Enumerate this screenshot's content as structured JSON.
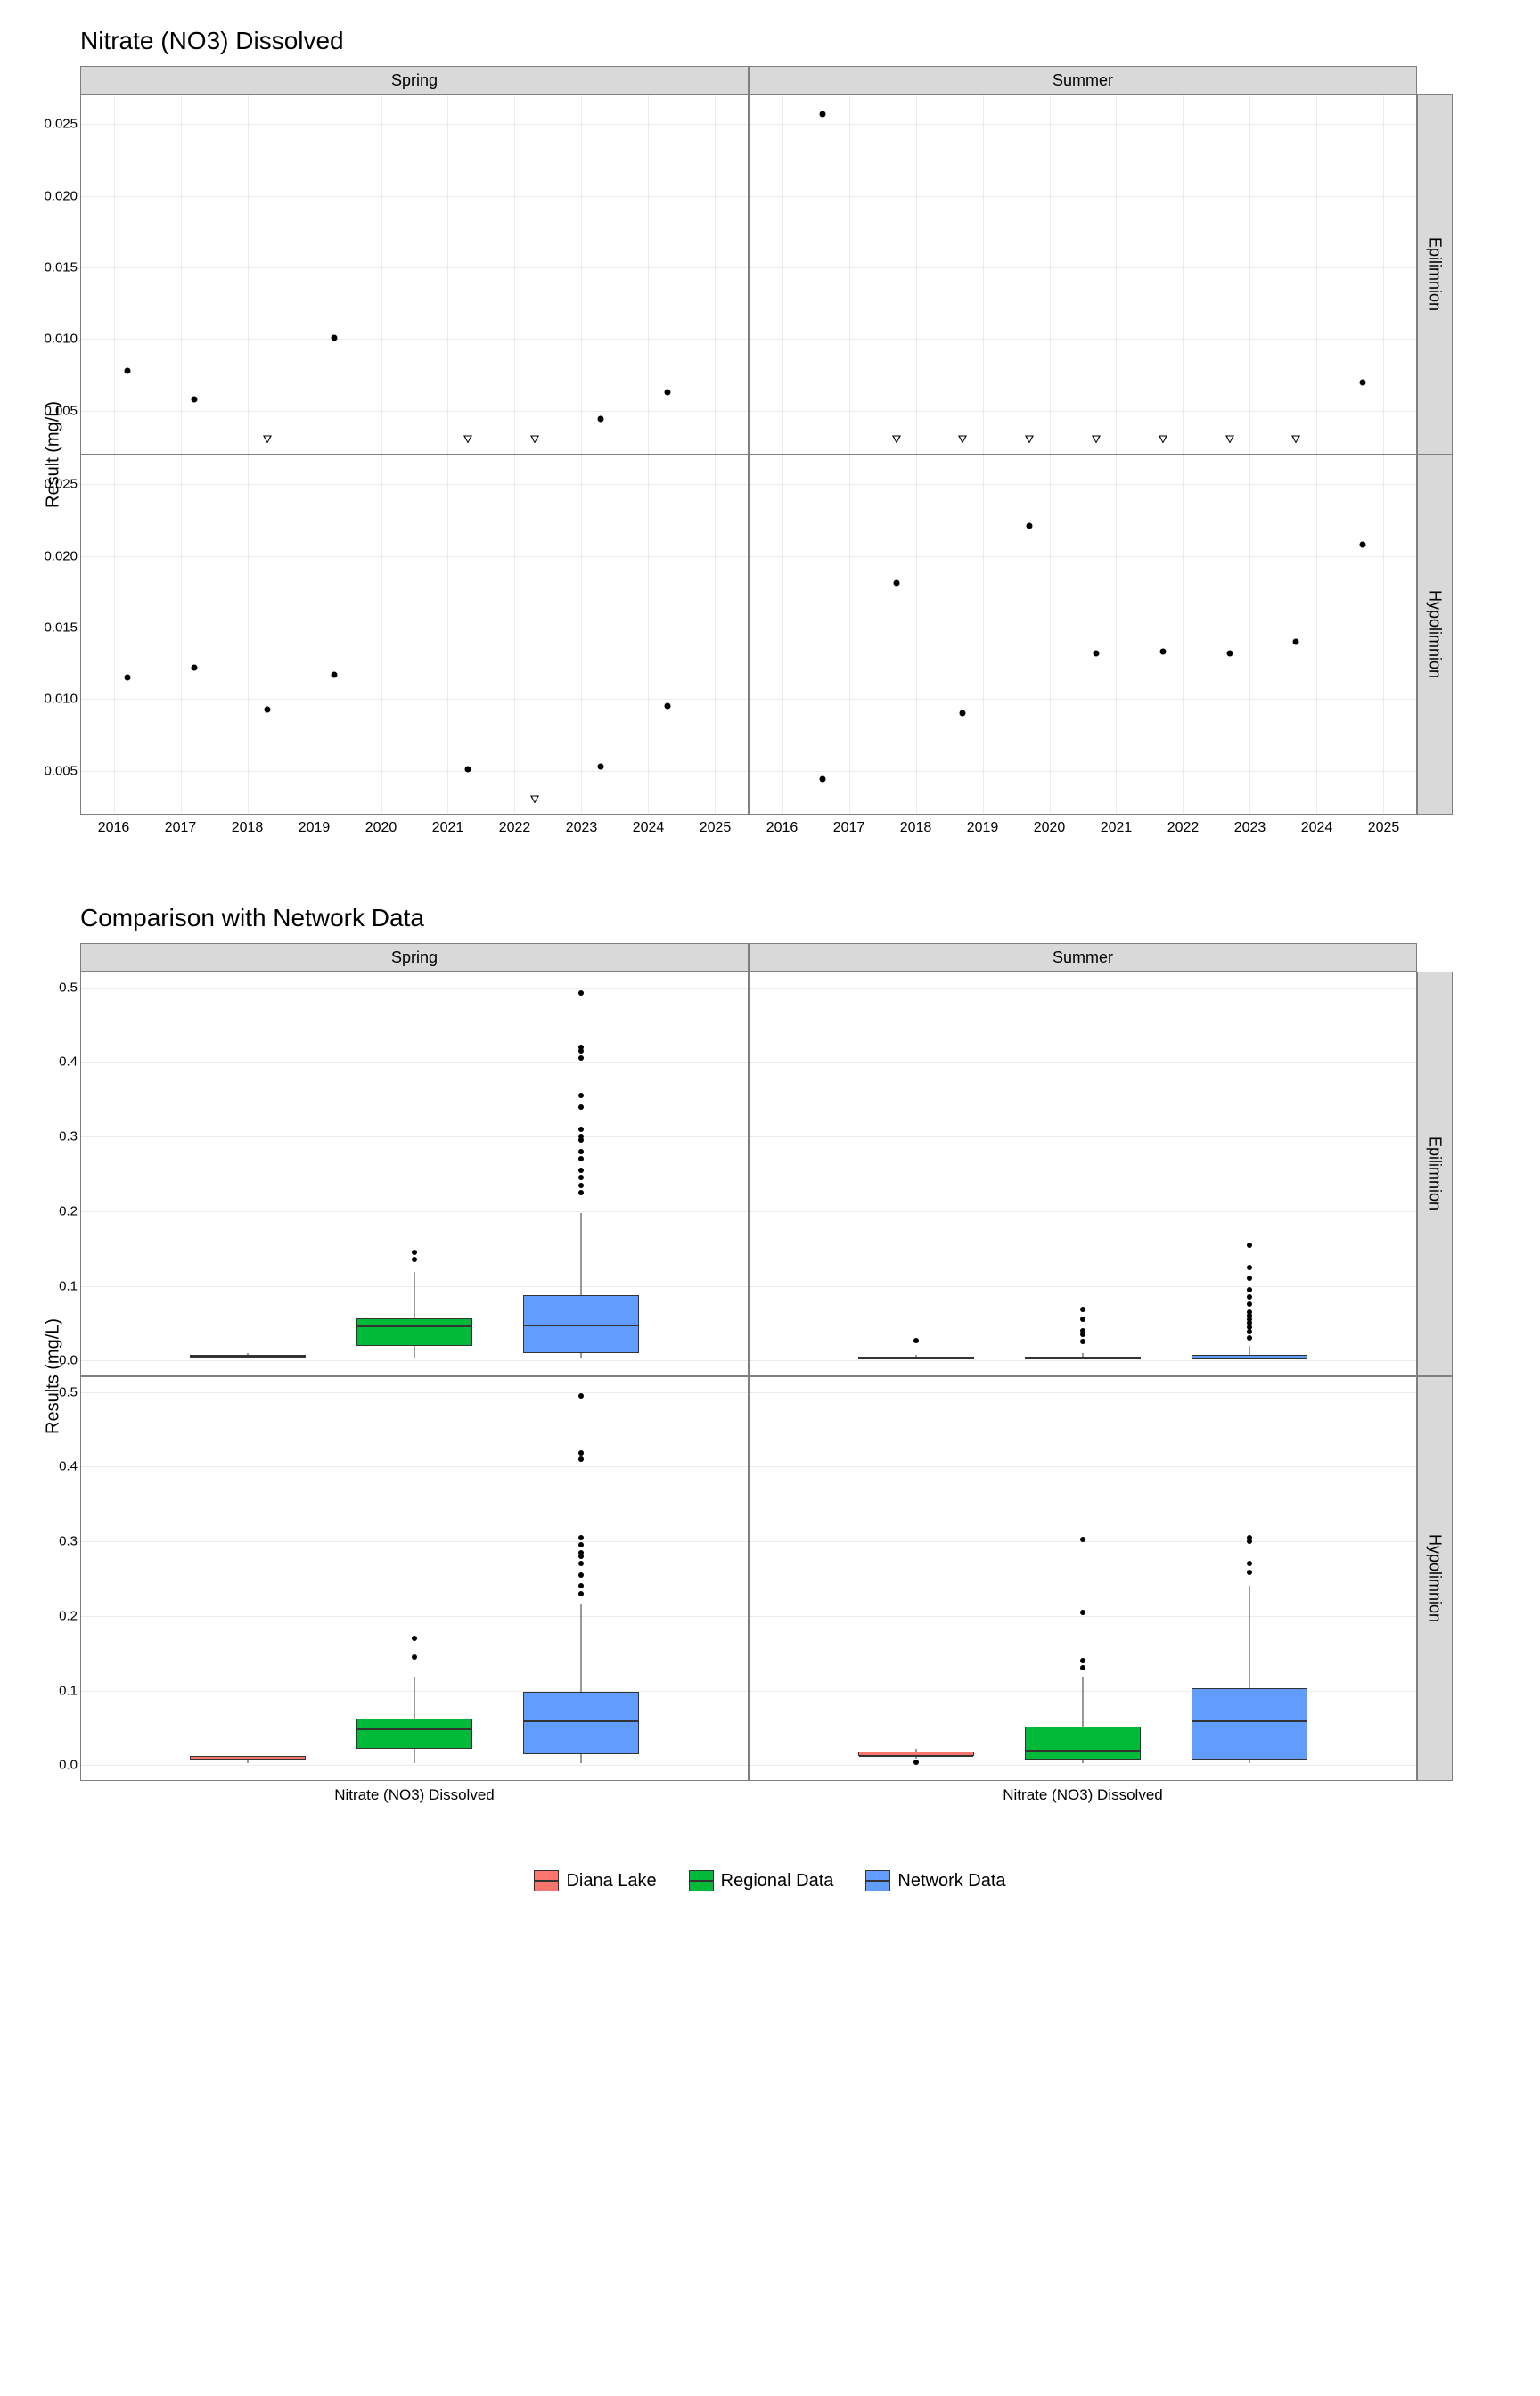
{
  "chart_data": [
    {
      "type": "scatter",
      "title": "Nitrate (NO3) Dissolved",
      "ylabel": "Result (mg/L)",
      "facet_cols": [
        "Spring",
        "Summer"
      ],
      "facet_rows": [
        "Epilimnion",
        "Hypolimnion"
      ],
      "xlim": [
        2015.5,
        2025.5
      ],
      "ylim": [
        0.002,
        0.027
      ],
      "xticks": [
        2016,
        2017,
        2018,
        2019,
        2020,
        2021,
        2022,
        2023,
        2024,
        2025
      ],
      "yticks": [
        0.005,
        0.01,
        0.015,
        0.02,
        0.025
      ],
      "panels": {
        "Spring_Epilimnion": {
          "points": [
            {
              "x": 2016.2,
              "y": 0.0078
            },
            {
              "x": 2017.2,
              "y": 0.0058
            },
            {
              "x": 2019.3,
              "y": 0.0101
            },
            {
              "x": 2023.3,
              "y": 0.0044
            },
            {
              "x": 2024.3,
              "y": 0.0063
            }
          ],
          "triangles": [
            {
              "x": 2018.3,
              "y": 0.003
            },
            {
              "x": 2021.3,
              "y": 0.003
            },
            {
              "x": 2022.3,
              "y": 0.003
            }
          ]
        },
        "Summer_Epilimnion": {
          "points": [
            {
              "x": 2016.6,
              "y": 0.0257
            },
            {
              "x": 2024.7,
              "y": 0.007
            }
          ],
          "triangles": [
            {
              "x": 2017.7,
              "y": 0.003
            },
            {
              "x": 2018.7,
              "y": 0.003
            },
            {
              "x": 2019.7,
              "y": 0.003
            },
            {
              "x": 2020.7,
              "y": 0.003
            },
            {
              "x": 2021.7,
              "y": 0.003
            },
            {
              "x": 2022.7,
              "y": 0.003
            },
            {
              "x": 2023.7,
              "y": 0.003
            }
          ]
        },
        "Spring_Hypolimnion": {
          "points": [
            {
              "x": 2016.2,
              "y": 0.0115
            },
            {
              "x": 2017.2,
              "y": 0.0122
            },
            {
              "x": 2018.3,
              "y": 0.0093
            },
            {
              "x": 2019.3,
              "y": 0.0117
            },
            {
              "x": 2021.3,
              "y": 0.0051
            },
            {
              "x": 2023.3,
              "y": 0.0053
            },
            {
              "x": 2024.3,
              "y": 0.0095
            }
          ],
          "triangles": [
            {
              "x": 2022.3,
              "y": 0.003
            }
          ]
        },
        "Summer_Hypolimnion": {
          "points": [
            {
              "x": 2016.6,
              "y": 0.0044
            },
            {
              "x": 2017.7,
              "y": 0.0181
            },
            {
              "x": 2018.7,
              "y": 0.009
            },
            {
              "x": 2019.7,
              "y": 0.0221
            },
            {
              "x": 2020.7,
              "y": 0.0132
            },
            {
              "x": 2021.7,
              "y": 0.0133
            },
            {
              "x": 2022.7,
              "y": 0.0132
            },
            {
              "x": 2023.7,
              "y": 0.014
            },
            {
              "x": 2024.7,
              "y": 0.0208
            }
          ],
          "triangles": []
        }
      }
    },
    {
      "type": "boxplot",
      "title": "Comparison with Network Data",
      "ylabel": "Results (mg/L)",
      "facet_cols": [
        "Spring",
        "Summer"
      ],
      "facet_rows": [
        "Epilimnion",
        "Hypolimnion"
      ],
      "xcategory": "Nitrate (NO3) Dissolved",
      "ylim": [
        -0.02,
        0.52
      ],
      "yticks": [
        0.0,
        0.1,
        0.2,
        0.3,
        0.4,
        0.5
      ],
      "series": [
        {
          "name": "Diana Lake",
          "color": "#F8766D"
        },
        {
          "name": "Regional Data",
          "color": "#00BA38"
        },
        {
          "name": "Network Data",
          "color": "#619CFF"
        }
      ],
      "panels": {
        "Spring_Epilimnion": {
          "boxes": [
            {
              "series": "Diana Lake",
              "min": 0.003,
              "q1": 0.004,
              "median": 0.006,
              "q3": 0.008,
              "max": 0.01,
              "outliers": []
            },
            {
              "series": "Regional Data",
              "min": 0.003,
              "q1": 0.02,
              "median": 0.047,
              "q3": 0.057,
              "max": 0.118,
              "outliers": [
                0.135,
                0.145
              ]
            },
            {
              "series": "Network Data",
              "min": 0.003,
              "q1": 0.01,
              "median": 0.048,
              "q3": 0.088,
              "max": 0.198,
              "outliers": [
                0.225,
                0.235,
                0.245,
                0.255,
                0.27,
                0.28,
                0.295,
                0.3,
                0.31,
                0.34,
                0.355,
                0.405,
                0.415,
                0.42,
                0.493
              ]
            }
          ]
        },
        "Summer_Epilimnion": {
          "boxes": [
            {
              "series": "Diana Lake",
              "min": 0.003,
              "q1": 0.003,
              "median": 0.003,
              "q3": 0.005,
              "max": 0.007,
              "outliers": [
                0.026
              ]
            },
            {
              "series": "Regional Data",
              "min": 0.003,
              "q1": 0.003,
              "median": 0.003,
              "q3": 0.005,
              "max": 0.01,
              "outliers": [
                0.025,
                0.035,
                0.04,
                0.055,
                0.068
              ]
            },
            {
              "series": "Network Data",
              "min": 0.003,
              "q1": 0.003,
              "median": 0.003,
              "q3": 0.008,
              "max": 0.02,
              "outliers": [
                0.03,
                0.038,
                0.045,
                0.05,
                0.055,
                0.06,
                0.065,
                0.075,
                0.085,
                0.095,
                0.11,
                0.125,
                0.155
              ]
            }
          ]
        },
        "Spring_Hypolimnion": {
          "boxes": [
            {
              "series": "Diana Lake",
              "min": 0.003,
              "q1": 0.006,
              "median": 0.009,
              "q3": 0.012,
              "max": 0.012,
              "outliers": []
            },
            {
              "series": "Regional Data",
              "min": 0.003,
              "q1": 0.022,
              "median": 0.05,
              "q3": 0.062,
              "max": 0.118,
              "outliers": [
                0.145,
                0.17
              ]
            },
            {
              "series": "Network Data",
              "min": 0.003,
              "q1": 0.015,
              "median": 0.06,
              "q3": 0.098,
              "max": 0.215,
              "outliers": [
                0.23,
                0.24,
                0.255,
                0.27,
                0.28,
                0.285,
                0.295,
                0.305,
                0.41,
                0.418,
                0.495
              ]
            }
          ]
        },
        "Summer_Hypolimnion": {
          "boxes": [
            {
              "series": "Diana Lake",
              "min": 0.009,
              "q1": 0.012,
              "median": 0.013,
              "q3": 0.018,
              "max": 0.022,
              "outliers": [
                0.004
              ]
            },
            {
              "series": "Regional Data",
              "min": 0.003,
              "q1": 0.008,
              "median": 0.02,
              "q3": 0.052,
              "max": 0.118,
              "outliers": [
                0.13,
                0.14,
                0.205,
                0.303
              ]
            },
            {
              "series": "Network Data",
              "min": 0.003,
              "q1": 0.008,
              "median": 0.06,
              "q3": 0.103,
              "max": 0.24,
              "outliers": [
                0.258,
                0.27,
                0.3,
                0.305
              ]
            }
          ]
        }
      }
    }
  ],
  "legend": {
    "items": [
      {
        "label": "Diana Lake",
        "color": "#F8766D"
      },
      {
        "label": "Regional Data",
        "color": "#00BA38"
      },
      {
        "label": "Network Data",
        "color": "#619CFF"
      }
    ]
  }
}
